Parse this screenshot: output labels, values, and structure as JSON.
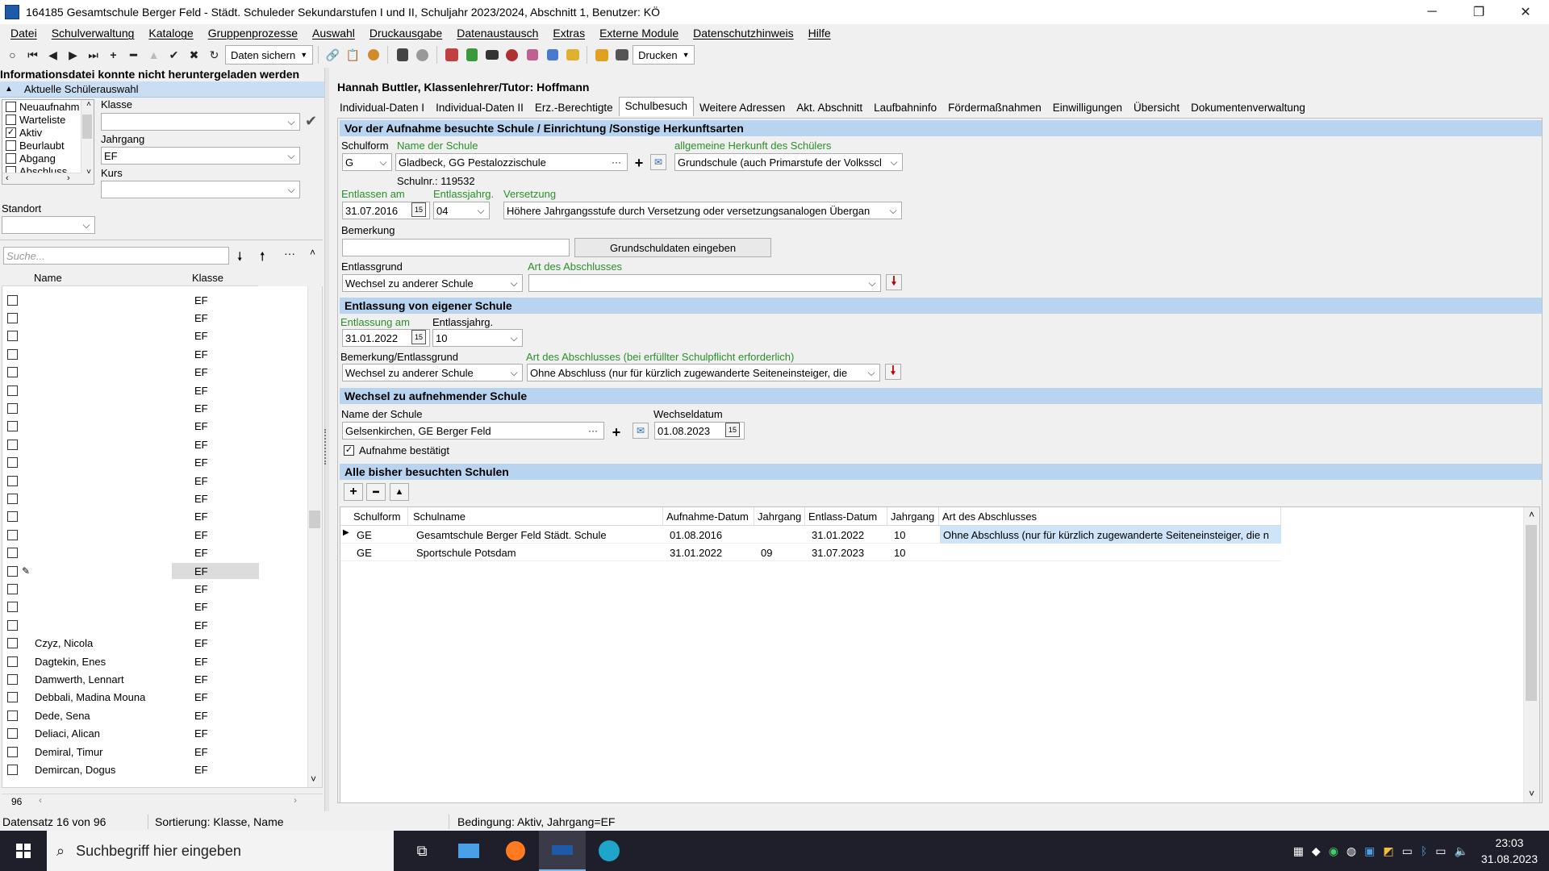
{
  "window": {
    "title": "164185 Gesamtschule Berger Feld - Städt. Schuleder Sekundarstufen I und II, Schuljahr 2023/2024, Abschnitt 1, Benutzer: KÖ",
    "minimize": "─",
    "maximize": "❐",
    "close": "✕"
  },
  "menu": [
    "Datei",
    "Schulverwaltung",
    "Kataloge",
    "Gruppenprozesse",
    "Auswahl",
    "Druckausgabe",
    "Datenaustausch",
    "Extras",
    "Externe Module",
    "Datenschutzhinweis",
    "Hilfe"
  ],
  "toolbar": {
    "save_label": "Daten sichern",
    "print_label": "Drucken"
  },
  "left": {
    "info": "Informationsdatei konnte nicht heruntergeladen werden",
    "selection_header": "Aktuelle Schülerauswahl",
    "status_items": [
      {
        "label": "Neuaufnahm",
        "checked": false
      },
      {
        "label": "Warteliste",
        "checked": false
      },
      {
        "label": "Aktiv",
        "checked": true
      },
      {
        "label": "Beurlaubt",
        "checked": false
      },
      {
        "label": "Abgang",
        "checked": false
      },
      {
        "label": "Abschluss",
        "checked": false
      }
    ],
    "klasse_label": "Klasse",
    "klasse_value": "",
    "jahrgang_label": "Jahrgang",
    "jahrgang_value": "EF",
    "kurs_label": "Kurs",
    "kurs_value": "",
    "standort_label": "Standort",
    "standort_value": "",
    "search_placeholder": "Suche...",
    "col_name": "Name",
    "col_klasse": "Klasse",
    "students": [
      {
        "name": "",
        "klasse": "EF"
      },
      {
        "name": "",
        "klasse": "EF"
      },
      {
        "name": "",
        "klasse": "EF"
      },
      {
        "name": "",
        "klasse": "EF"
      },
      {
        "name": "",
        "klasse": "EF"
      },
      {
        "name": "",
        "klasse": "EF"
      },
      {
        "name": "",
        "klasse": "EF"
      },
      {
        "name": "",
        "klasse": "EF"
      },
      {
        "name": "",
        "klasse": "EF"
      },
      {
        "name": "",
        "klasse": "EF"
      },
      {
        "name": "",
        "klasse": "EF"
      },
      {
        "name": "",
        "klasse": "EF"
      },
      {
        "name": "",
        "klasse": "EF"
      },
      {
        "name": "",
        "klasse": "EF"
      },
      {
        "name": "",
        "klasse": "EF"
      },
      {
        "name": "",
        "klasse": "EF"
      },
      {
        "name": "",
        "klasse": "EF"
      },
      {
        "name": "",
        "klasse": "EF"
      },
      {
        "name": "",
        "klasse": "EF"
      },
      {
        "name": "Czyz, Nicola",
        "klasse": "EF"
      },
      {
        "name": "Dagtekin, Enes",
        "klasse": "EF"
      },
      {
        "name": "Damwerth, Lennart",
        "klasse": "EF"
      },
      {
        "name": "Debbali, Madina Mouna",
        "klasse": "EF"
      },
      {
        "name": "Dede, Sena",
        "klasse": "EF"
      },
      {
        "name": "Deliaci, Alican",
        "klasse": "EF"
      },
      {
        "name": "Demiral, Timur",
        "klasse": "EF"
      },
      {
        "name": "Demircan, Dogus",
        "klasse": "EF"
      }
    ],
    "count": "96"
  },
  "student_header": "Hannah Buttler, Klassenlehrer/Tutor: Hoffmann",
  "tabs": [
    "Individual-Daten I",
    "Individual-Daten II",
    "Erz.-Berechtigte",
    "Schulbesuch",
    "Weitere Adressen",
    "Akt. Abschnitt",
    "Laufbahninfo",
    "Fördermaßnahmen",
    "Einwilligungen",
    "Übersicht",
    "Dokumentenverwaltung"
  ],
  "sec1": {
    "title": "Vor der Aufnahme besuchte Schule / Einrichtung /Sonstige Herkunftsarten",
    "schulform_label": "Schulform",
    "schulform_value": "G",
    "name_label": "Name der Schule",
    "name_value": "Gladbeck, GG Pestalozzischule",
    "herkunft_label": "allgemeine Herkunft des Schülers",
    "herkunft_value": "Grundschule (auch Primarstufe der Volksscl",
    "schulnr": "Schulnr.:  119532",
    "entlassen_label": "Entlassen am",
    "entlassen_value": "31.07.2016",
    "entlassjahrg_label": "Entlassjahrg.",
    "entlassjahrg_value": "04",
    "versetzung_label": "Versetzung",
    "versetzung_value": "Höhere Jahrgangsstufe durch Versetzung oder versetzungsanalogen Übergan",
    "bemerkung_label": "Bemerkung",
    "bemerkung_value": "",
    "grundschul_btn": "Grundschuldaten eingeben",
    "entlassgrund_label": "Entlassgrund",
    "entlassgrund_value": "Wechsel zu anderer Schule",
    "abschluss_label": "Art des Abschlusses",
    "abschluss_value": ""
  },
  "sec2": {
    "title": "Entlassung von eigener Schule",
    "entlassung_label": "Entlassung am",
    "entlassung_value": "31.01.2022",
    "entlassjahrg_label": "Entlassjahrg.",
    "entlassjahrg_value": "10",
    "bemerkung_label": "Bemerkung/Entlassgrund",
    "bemerkung_value": "Wechsel zu anderer Schule",
    "abschluss_label": "Art des Abschlusses (bei erfüllter Schulpflicht erforderlich)",
    "abschluss_value": "Ohne Abschluss (nur für kürzlich zugewanderte Seiteneinsteiger, die"
  },
  "sec3": {
    "title": "Wechsel zu aufnehmender Schule",
    "name_label": "Name der Schule",
    "name_value": "Gelsenkirchen, GE Berger Feld",
    "datum_label": "Wechseldatum",
    "datum_value": "01.08.2023",
    "bestaetigt_label": "Aufnahme bestätigt"
  },
  "sec4": {
    "title": "Alle bisher besuchten Schulen",
    "columns": [
      "Schulform",
      "Schulname",
      "Aufnahme-Datum",
      "Jahrgang",
      "Entlass-Datum",
      "Jahrgang",
      "Art des Abschlusses"
    ],
    "rows": [
      [
        "GE",
        "Gesamtschule Berger Feld Städt. Schule",
        "01.08.2016",
        "",
        "31.01.2022",
        "10",
        "Ohne Abschluss (nur für kürzlich zugewanderte Seiteneinsteiger, die n"
      ],
      [
        "GE",
        "Sportschule Potsdam",
        "31.01.2022",
        "09",
        "31.07.2023",
        "10",
        ""
      ]
    ]
  },
  "status": {
    "record": "Datensatz 16 von 96",
    "sort": "Sortierung: Klasse, Name",
    "condition": "Bedingung: Aktiv, Jahrgang=EF"
  },
  "taskbar": {
    "search_placeholder": "Suchbegriff hier eingeben",
    "time": "23:03",
    "date": "31.08.2023"
  },
  "colors": {
    "section_header": "#b8d4f0",
    "selection_header": "#c9ddf3",
    "accent_green": "#2a8f2a",
    "taskbar": "#1f1f2b"
  }
}
